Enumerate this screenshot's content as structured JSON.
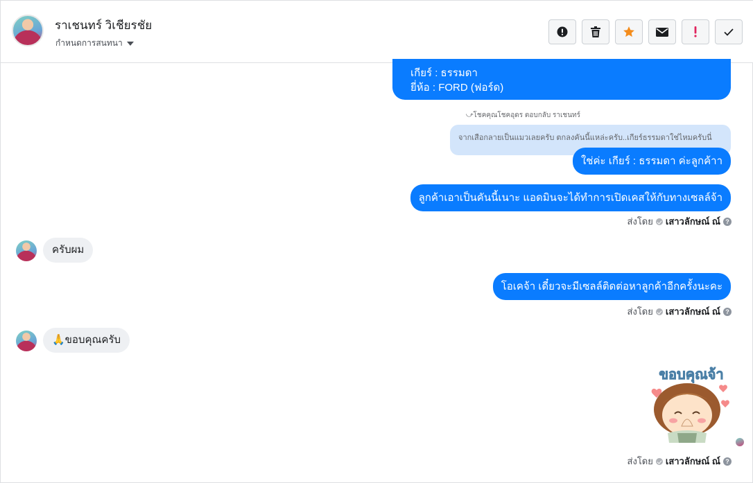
{
  "header": {
    "user_name": "ราเชนทร์ วิเชียรชัย",
    "conversation_setting": "กำหนดการสนทนา",
    "toolbar": {
      "mark_spam_icon": "alert-circle-icon",
      "delete_icon": "trash-icon",
      "star_icon": "star-icon",
      "star_color": "#f48c1b",
      "mark_unread_icon": "envelope-icon",
      "important_icon": "exclamation-icon",
      "important_color": "#e0245e",
      "done_icon": "check-icon"
    }
  },
  "messages": {
    "m1_line1": "เกียร์ : ธรรมดา",
    "m1_line2": "ยี่ห้อ : FORD (ฟอร์ด)",
    "reply_label": "โชคคุณโชคอุดร ตอบกลับ ราเชนทร์",
    "quoted_text": "จากเสือกลายเป็นแมวเลยครับ ตกลงคันนี้แหล่ะครับ..เกียร์ธรรมดาใช่ไหมครับนี่",
    "m2": "ใช่ค่ะ เกียร์ : ธรรมดา ค่ะลูกค้าา",
    "m3": "ลูกค้าเอาเป็นคันนี้เนาะ แอดมินจะได้ทำการเปิดเคสให้กับทางเซลล์จ้า",
    "in1": "ครับผม",
    "m4": "โอเคจ้า เดี๋ยวจะมีเซลล์ติดต่อหาลูกค้าอีกครั้งนะคะ",
    "in2": "🙏ขอบคุณครับ",
    "sticker_text": "ขอบคุณจ้า"
  },
  "sent_by": {
    "prefix": "ส่งโดย",
    "agent": "เสาวลักษณ์ ณ์"
  },
  "colors": {
    "outgoing_bubble": "#0a7cff",
    "incoming_bubble": "#eef0f3",
    "quote_bubble": "#d3e5fb"
  }
}
